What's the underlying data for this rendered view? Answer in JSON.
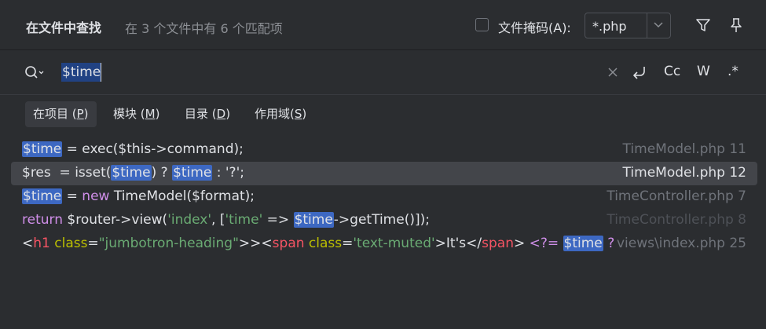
{
  "header": {
    "title": "在文件中查找",
    "subtitle": "在 3 个文件中有 6 个匹配项",
    "file_mask_label": "文件掩码(A):",
    "file_mask_value": "*.php",
    "filter_icon": "filter-icon",
    "pin_icon": "pin-icon"
  },
  "search": {
    "query": "$time",
    "icon": "search-icon",
    "clear_icon": "clear-icon",
    "newline_icon": "newline-icon",
    "match_case_label": "Cc",
    "words_label": "W",
    "regex_label": ".*"
  },
  "scopes": [
    {
      "label": "在项目 (",
      "key": "P",
      "tail": ")",
      "active": true
    },
    {
      "label": "模块 (",
      "key": "M",
      "tail": ")",
      "active": false
    },
    {
      "label": "目录 (",
      "key": "D",
      "tail": ")",
      "active": false
    },
    {
      "label": "作用域(",
      "key": "S",
      "tail": ")",
      "active": false
    }
  ],
  "results": [
    {
      "location": "TimeModel.php 11",
      "selected": false
    },
    {
      "location": "TimeModel.php 12",
      "selected": true
    },
    {
      "location": "TimeController.php 7",
      "selected": false
    },
    {
      "location": "TimeController.php 8",
      "selected": false
    },
    {
      "location": "views\\index.php 25",
      "selected": false
    }
  ],
  "code": {
    "r1": {
      "m1": "$time",
      "rest": " = exec($this->command);"
    },
    "r2": {
      "a": "$res  = isset(",
      "m1": "$time",
      "b": ") ? ",
      "m2": "$time",
      "c": " : '?';"
    },
    "r3": {
      "m1": "$time",
      "b": " = ",
      "kw": "new",
      "c": " TimeModel($format);"
    },
    "r4": {
      "kw": "return",
      "a": " $router->view(",
      "s1": "'index'",
      "b": ", [",
      "s2": "'time'",
      "c": " => ",
      "m1": "$time",
      "d": "->getTime()]);"
    },
    "r5": {
      "lt1": "<",
      "t1": "h1",
      "sp1": " ",
      "a1": "class",
      "eq1": "=",
      "s1": "\"jumbotron-heading\"",
      "gt1": ">",
      "gt1b": ">",
      "lt2": "<",
      "t2": "span",
      "sp2": " ",
      "a2": "class",
      "eq2": "=",
      "s2": "'text-muted'",
      "gt2": ">",
      "txt": "It's",
      "lt3": "</",
      "t3": "span",
      "gt3": ">",
      "sp3": " ",
      "php": "<?=",
      "sp4": " ",
      "m1": "$time",
      "sp5": " ",
      "q": "?"
    }
  },
  "colors": {
    "background": "#2b2d30",
    "match_highlight": "#3d68c2",
    "selected_row": "#43454a",
    "keyword": "#cf8ee8",
    "string": "#6aab73",
    "tag": "#f75464"
  }
}
